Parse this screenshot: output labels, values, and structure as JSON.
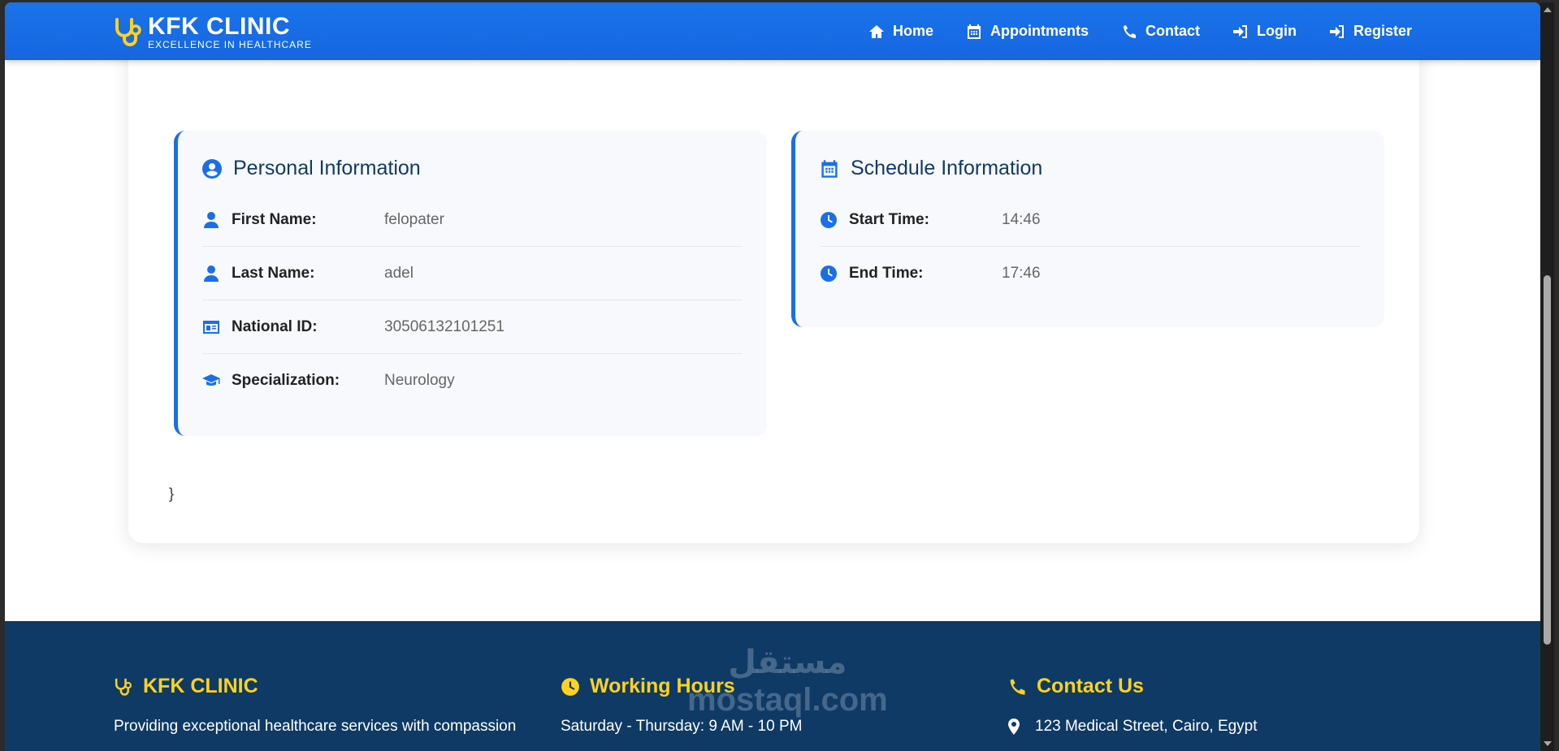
{
  "brand": {
    "title": "KFK CLINIC",
    "subtitle": "EXCELLENCE IN HEALTHCARE"
  },
  "nav": [
    {
      "label": "Home",
      "icon": "home-icon"
    },
    {
      "label": "Appointments",
      "icon": "calendar-icon"
    },
    {
      "label": "Contact",
      "icon": "phone-icon"
    },
    {
      "label": "Login",
      "icon": "sign-in-icon"
    },
    {
      "label": "Register",
      "icon": "sign-in-icon"
    }
  ],
  "personal": {
    "title": "Personal Information",
    "rows": [
      {
        "label": "First Name:",
        "value": "felopater",
        "icon": "user-icon"
      },
      {
        "label": "Last Name:",
        "value": "adel",
        "icon": "user-icon"
      },
      {
        "label": "National ID:",
        "value": "30506132101251",
        "icon": "id-card-icon"
      },
      {
        "label": "Specialization:",
        "value": "Neurology",
        "icon": "graduation-cap-icon"
      }
    ]
  },
  "schedule": {
    "title": "Schedule Information",
    "rows": [
      {
        "label": "Start Time:",
        "value": "14:46",
        "icon": "clock-icon"
      },
      {
        "label": "End Time:",
        "value": "17:46",
        "icon": "clock-icon"
      }
    ]
  },
  "stray_brace": "}",
  "footer": {
    "brand": {
      "title": "KFK CLINIC",
      "text": "Providing exceptional healthcare services with compassion"
    },
    "hours": {
      "title": "Working Hours",
      "text": "Saturday - Thursday: 9 AM - 10 PM"
    },
    "contact": {
      "title": "Contact Us",
      "text": "123 Medical Street, Cairo, Egypt"
    }
  },
  "watermark": {
    "arabic": "مستقل",
    "latin": "mostaql.com"
  },
  "colors": {
    "primary": "#1a6fe8",
    "footer_bg": "#0e3a65",
    "accent": "#ffd21e",
    "title": "#123a66"
  }
}
